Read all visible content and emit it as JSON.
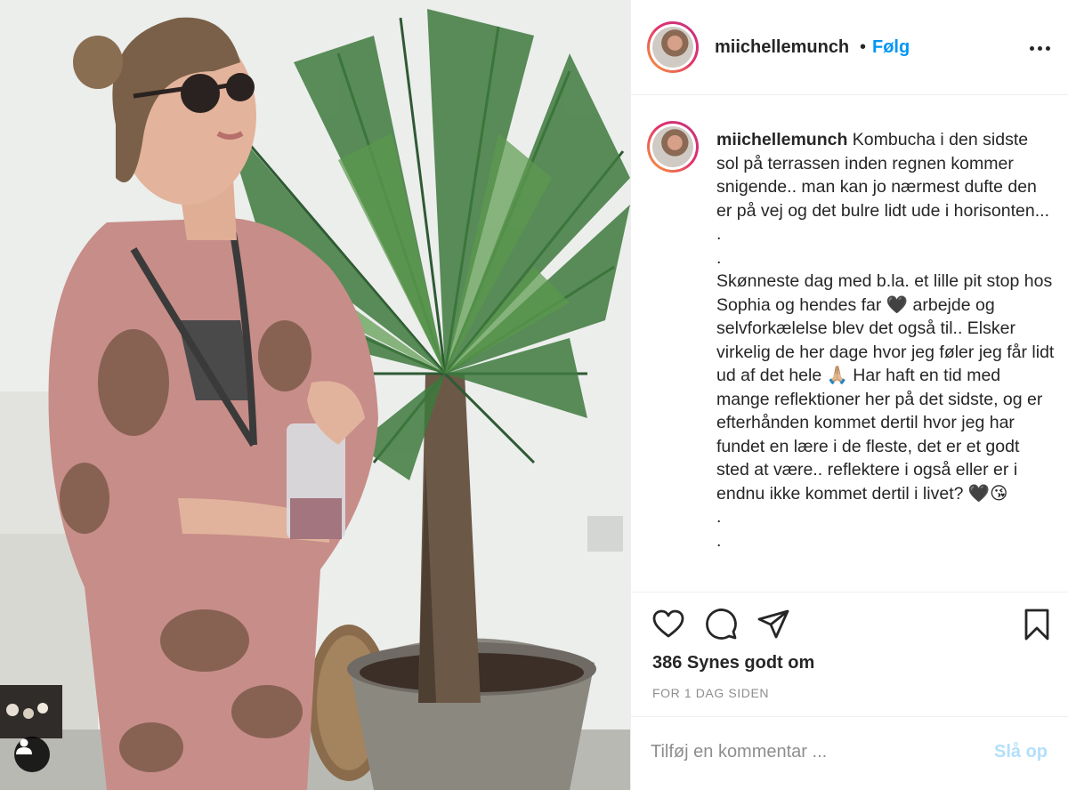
{
  "header": {
    "username": "miichellemunch",
    "separator": "•",
    "follow_label": "Følg",
    "more_icon": "more-horizontal-icon"
  },
  "caption": {
    "username": "miichellemunch",
    "text": " Kombucha i den sidste sol på terrassen inden regnen kommer snigende.. man kan jo nærmest dufte den er på vej og det bulre lidt ude i horisonten... .\n.\nSkønneste dag med b.la. et lille pit stop hos Sophia og hendes far 🖤 arbejde og selvforkælelse blev det også til.. Elsker virkelig de her dage hvor jeg føler jeg får lidt ud af det hele 🙏🏼 Har haft en tid med mange reflektioner her på det sidste, og er efterhånden kommet dertil hvor jeg har fundet en lære i de fleste, det er et godt sted at være.. reflektere i også eller er i endnu ikke kommet dertil i livet? 🖤😘\n.\n."
  },
  "actions": {
    "like_icon": "heart-icon",
    "comment_icon": "comment-icon",
    "share_icon": "share-icon",
    "save_icon": "bookmark-icon",
    "likes_text": "386 Synes godt om",
    "timestamp": "FOR 1 DAG SIDEN"
  },
  "comment": {
    "placeholder": "Tilføj en kommentar ...",
    "post_label": "Slå op"
  },
  "colors": {
    "link_blue": "#0095f6",
    "post_disabled": "#b2dffc",
    "muted": "#8e8e8e"
  }
}
